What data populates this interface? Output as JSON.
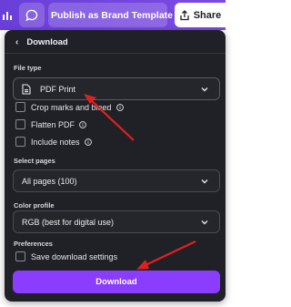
{
  "topbar": {
    "publish_label": "Publish as Brand Template",
    "share_label": "Share"
  },
  "panel": {
    "title": "Download",
    "file_type_label": "File type",
    "file_type_value": "PDF Print",
    "options": [
      {
        "label": "Crop marks and bleed",
        "checked": false,
        "has_info": true
      },
      {
        "label": "Flatten PDF",
        "checked": false,
        "has_info": true
      },
      {
        "label": "Include notes",
        "checked": false,
        "has_info": true
      }
    ],
    "select_pages_label": "Select pages",
    "select_pages_value": "All pages (100)",
    "color_profile_label": "Color profile",
    "color_profile_value": "RGB (best for digital use)",
    "preferences_label": "Preferences",
    "save_settings_label": "Save download settings",
    "download_button_label": "Download"
  },
  "colors": {
    "topbar": "#7c4ae3",
    "panel_bg": "#202126",
    "accent": "#8b3dff",
    "annotation_arrow": "#e02020"
  },
  "icons": [
    "chart-icon",
    "comment-icon",
    "publish-template-icon",
    "share-icon",
    "back-chevron-icon",
    "file-icon",
    "chevron-down-icon",
    "info-icon"
  ]
}
